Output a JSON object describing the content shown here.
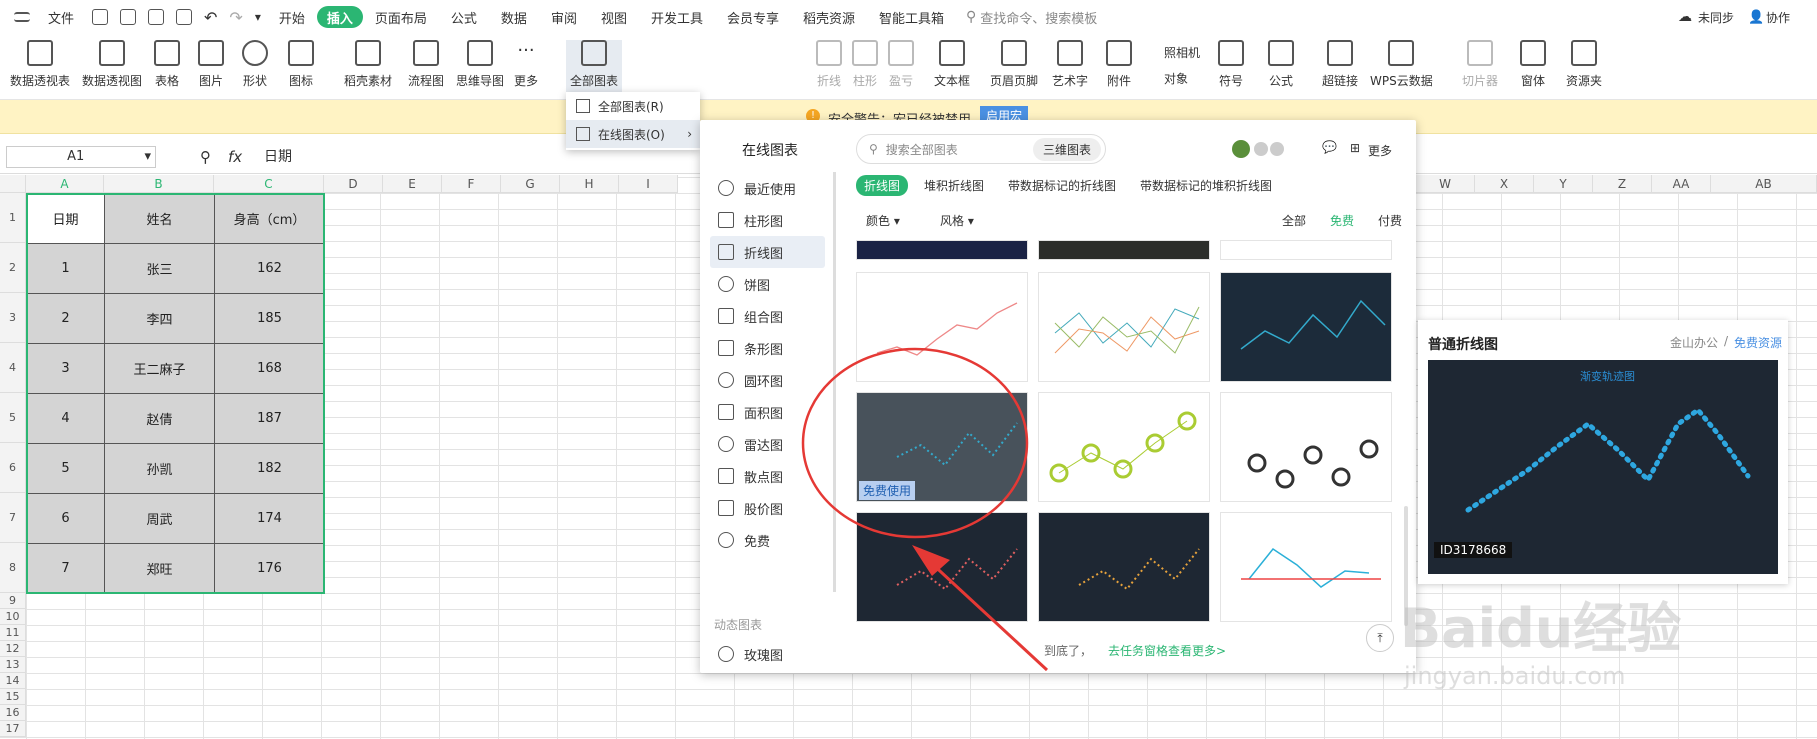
{
  "menubar": {
    "file": "文件",
    "tabs": [
      "开始",
      "插入",
      "页面布局",
      "公式",
      "数据",
      "审阅",
      "视图",
      "开发工具",
      "会员专享",
      "稻壳资源",
      "智能工具箱"
    ],
    "active_tab": "插入",
    "search": "查找命令、搜索模板",
    "sync": "未同步",
    "collab": "协作"
  },
  "ribbon": {
    "items": [
      "数据透视表",
      "数据透视图",
      "表格",
      "图片",
      "形状",
      "图标",
      "稻壳素材",
      "流程图",
      "思维导图",
      "更多",
      "全部图表",
      "折线",
      "柱形",
      "盈亏",
      "文本框",
      "页眉页脚",
      "艺术字",
      "附件",
      "符号",
      "公式",
      "超链接",
      "WPS云数据",
      "切片器",
      "窗体",
      "资源夹"
    ],
    "camera": "照相机",
    "object": "对象"
  },
  "dropdown": {
    "all_charts": "全部图表(R)",
    "online_charts": "在线图表(O)"
  },
  "warning": {
    "text": "安全警告：宏已经被禁用",
    "button": "启用宏"
  },
  "formula": {
    "cell": "A1",
    "fx": "fx",
    "value": "日期"
  },
  "columns": [
    "A",
    "B",
    "C",
    "D",
    "E",
    "F",
    "G",
    "H",
    "I",
    "W",
    "X",
    "Y",
    "Z",
    "AA",
    "AB"
  ],
  "rows": [
    "1",
    "2",
    "3",
    "4",
    "5",
    "6",
    "7",
    "8",
    "9",
    "10",
    "11",
    "12",
    "13",
    "14",
    "15",
    "16",
    "17"
  ],
  "table": {
    "headers": [
      "日期",
      "姓名",
      "身高（cm）"
    ],
    "data": [
      [
        "1",
        "张三",
        "162"
      ],
      [
        "2",
        "李四",
        "185"
      ],
      [
        "3",
        "王二麻子",
        "168"
      ],
      [
        "4",
        "赵倩",
        "187"
      ],
      [
        "5",
        "孙凯",
        "182"
      ],
      [
        "6",
        "周武",
        "174"
      ],
      [
        "7",
        "郑旺",
        "176"
      ]
    ]
  },
  "popup": {
    "title": "在线图表",
    "search_placeholder": "搜索全部图表",
    "tab_3d": "三维图表",
    "more": "更多",
    "side": [
      "最近使用",
      "柱形图",
      "折线图",
      "饼图",
      "组合图",
      "条形图",
      "圆环图",
      "面积图",
      "雷达图",
      "散点图",
      "股价图",
      "免费"
    ],
    "dynamic_section": "动态图表",
    "dynamic_item": "玫瑰图",
    "subtabs": [
      "折线图",
      "堆积折线图",
      "带数据标记的折线图",
      "带数据标记的堆积折线图"
    ],
    "filter_color": "颜色",
    "filter_style": "风格",
    "price": [
      "全部",
      "免费",
      "付费"
    ],
    "free_badge": "免费使用",
    "footer_text": "到底了，",
    "footer_link": "去任务窗格查看更多>"
  },
  "preview": {
    "title": "普通折线图",
    "source_a": "金山办公",
    "source_b": "免费资源",
    "chart_title": "渐变轨迹图",
    "id": "ID3178668"
  },
  "watermark": {
    "brand": "Baidu经验",
    "url": "jingyan.baidu.com"
  },
  "colors": {
    "accent": "#2bb673",
    "warn_bg": "#fff3c4",
    "dark_chart": "#1e2733",
    "annotation": "#e53935"
  }
}
